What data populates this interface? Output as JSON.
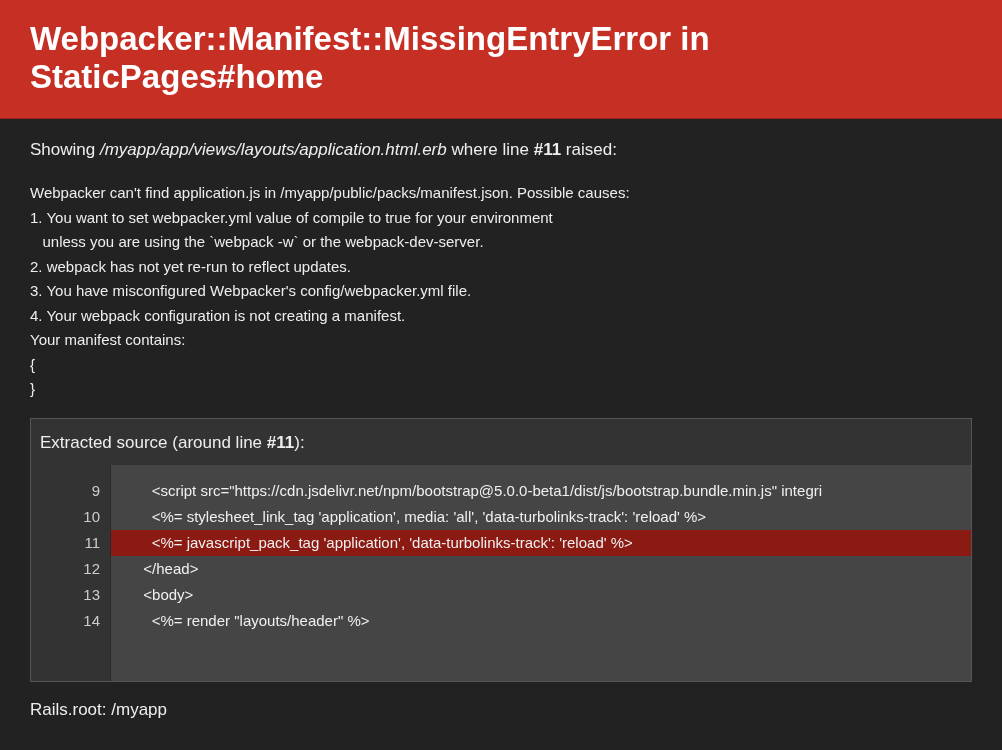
{
  "header": {
    "title": "Webpacker::Manifest::MissingEntryError in StaticPages#home"
  },
  "showing": "Showing */myapp/app/views/layouts/application.html.erb* where line **#11** raised:",
  "message_lines": [
    "Webpacker can't find application.js in /myapp/public/packs/manifest.json. Possible causes:",
    "1. You want to set webpacker.yml value of compile to true for your environment",
    "   unless you are using the `webpack -w` or the webpack-dev-server.",
    "2. webpack has not yet re-run to reflect updates.",
    "3. You have misconfigured Webpacker's config/webpacker.yml file.",
    "4. Your webpack configuration is not creating a manifest.",
    "Your manifest contains:",
    "{",
    "}"
  ],
  "source": {
    "title": "Extracted source (around line **#11**):",
    "lines": [
      {
        "number": "9",
        "code": "    <script src=\"https://cdn.jsdelivr.net/npm/bootstrap@5.0.0-beta1/dist/js/bootstrap.bundle.min.js\" integri",
        "selected": false
      },
      {
        "number": "10",
        "code": "    <%= stylesheet_link_tag 'application', media: 'all', 'data-turbolinks-track': 'reload' %>",
        "selected": false
      },
      {
        "number": "11",
        "code": "    <%= javascript_pack_tag 'application', 'data-turbolinks-track': 'reload' %>",
        "selected": true
      },
      {
        "number": "12",
        "code": "  </head>",
        "selected": false
      },
      {
        "number": "13",
        "code": "  <body>",
        "selected": false
      },
      {
        "number": "14",
        "code": "    <%= render \"layouts/header\" %>",
        "selected": false
      }
    ]
  },
  "rails_root": "Rails.root: /myapp"
}
